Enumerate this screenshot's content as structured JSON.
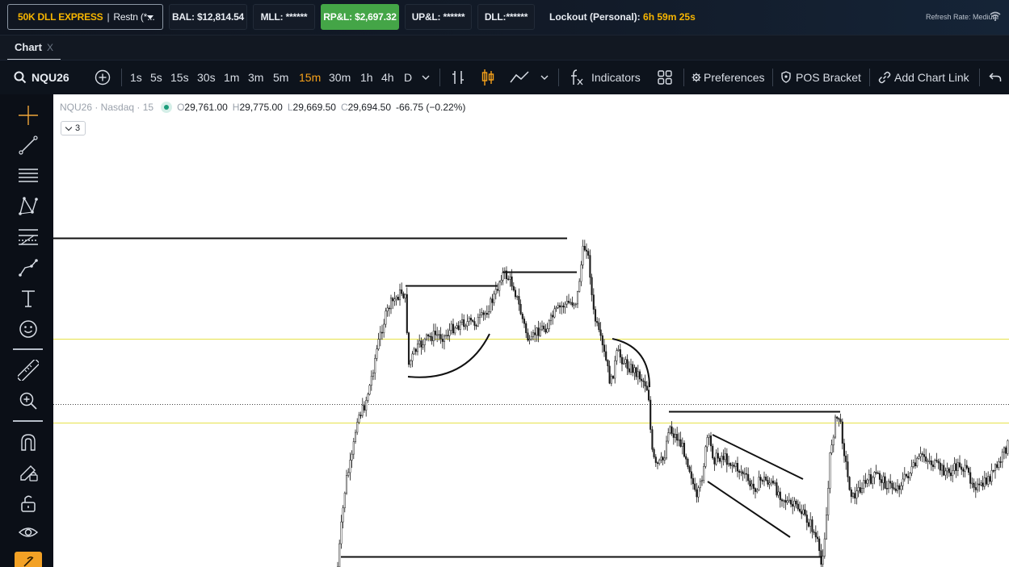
{
  "account": {
    "name": "50K DLL EXPRESS",
    "separator": "|",
    "user": "Restn (*...",
    "balance": "BAL: $12,814.54",
    "mll": "MLL: ******",
    "rpl": "RP&L: $2,697.32",
    "upl": "UP&L: ******",
    "dll": "DLL:******",
    "lockout_label": "Lockout (Personal):",
    "lockout_time": "6h 59m 25s",
    "refresh_rate": "Refresh Rate: Medium",
    "colors": {
      "accent": "#f7b500",
      "rpl_bg": "#44a547"
    }
  },
  "tab": {
    "label": "Chart",
    "close": "X"
  },
  "toolbar": {
    "symbol": "NQU26",
    "intervals": [
      "1s",
      "5s",
      "15s",
      "30s",
      "1m",
      "3m",
      "5m",
      "15m",
      "30m",
      "1h",
      "4h",
      "D"
    ],
    "active_interval": "15m",
    "indicators_label": "Indicators",
    "preferences_label": "Preferences",
    "pos_bracket_label": "POS Bracket",
    "add_chart_link_label": "Add Chart Link",
    "colors": {
      "active": "#f7a21a"
    }
  },
  "sidebar": {
    "tools": [
      "crosshair-icon",
      "trend-line-icon",
      "horizontal-lines-icon",
      "pattern-icon",
      "fib-icon",
      "path-icon",
      "text-icon",
      "emoji-icon",
      "ruler-icon",
      "zoom-in-icon",
      "magnet-icon",
      "lock-drawing-icon",
      "unlock-icon",
      "eye-icon",
      "link-icon"
    ]
  },
  "chart": {
    "symbol_label": "NQU26 · Nasdaq · 15",
    "o_label": "O",
    "o_value": "29,761.00",
    "h_label": "H",
    "h_value": "29,775.00",
    "l_label": "L",
    "l_value": "29,669.50",
    "c_label": "C",
    "c_value": "29,694.50",
    "change": "-66.75 (−0.22%)",
    "indicator_count": "3"
  }
}
